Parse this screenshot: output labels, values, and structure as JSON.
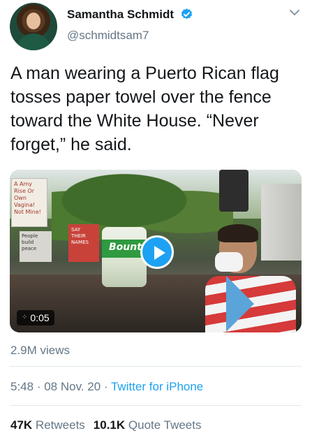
{
  "author": {
    "display_name": "Samantha Schmidt",
    "handle": "@schmidtsam7",
    "verified": true
  },
  "tweet": {
    "text": "A man wearing a Puerto Rican flag tosses paper towel over the fence toward the White House. “Never forget,” he said."
  },
  "media": {
    "duration": "0:05",
    "sign_texts": [
      "A Amy Rise Or Own Vagina! Not Mine!",
      "SAY THEIR NAMES",
      "People build peace"
    ],
    "towel_brand": "Bounty"
  },
  "views": "2.9M views",
  "timestamp": {
    "time": "5:48",
    "separator": " · ",
    "date": "08 Nov. 20",
    "source": "Twitter for iPhone"
  },
  "stats": {
    "retweets_count": "47K",
    "retweets_label": "Retweets",
    "quote_count": "10.1K",
    "quote_label": "Quote Tweets"
  },
  "colors": {
    "accent": "#1da1f2",
    "secondary_text": "#657786",
    "primary_text": "#14171a"
  },
  "icons": [
    "verified-badge-icon",
    "chevron-down-icon",
    "play-icon",
    "gif-icon"
  ]
}
